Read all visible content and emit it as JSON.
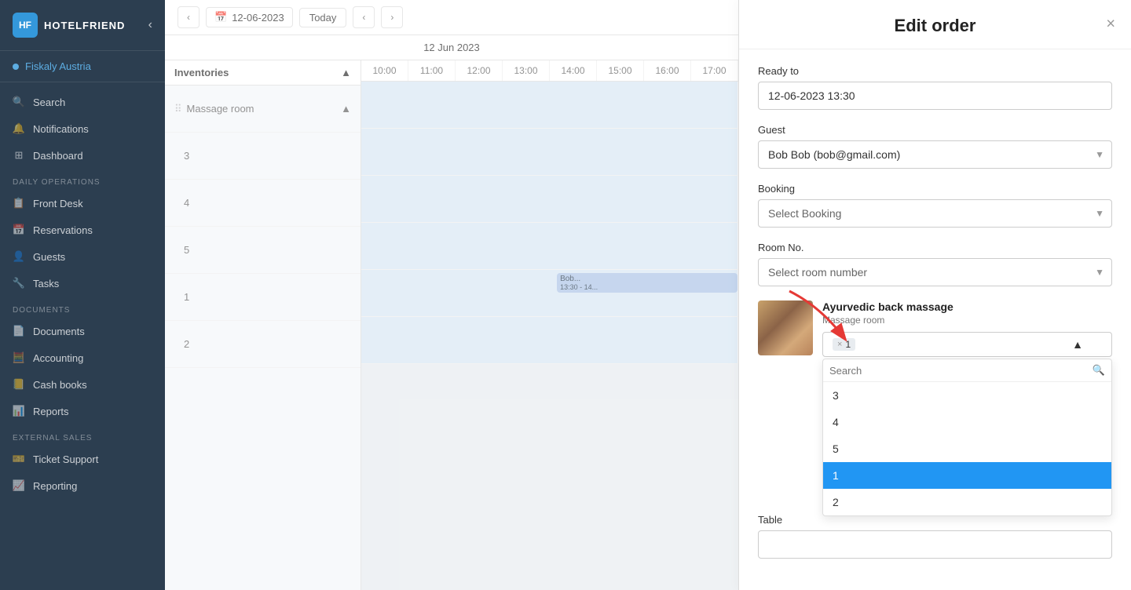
{
  "sidebar": {
    "logo_text": "HOTELFRIEND",
    "property": "Fiskaly Austria",
    "nav_items": [
      {
        "id": "search",
        "label": "Search",
        "icon": "🔍",
        "section": null
      },
      {
        "id": "notifications",
        "label": "Notifications",
        "icon": "🔔",
        "section": null
      },
      {
        "id": "dashboard",
        "label": "Dashboard",
        "icon": "⊞",
        "section": null
      },
      {
        "id": "section_daily",
        "label": "DAILY OPERATIONS",
        "is_section": true
      },
      {
        "id": "front-desk",
        "label": "Front Desk",
        "icon": "📋",
        "section": "daily"
      },
      {
        "id": "reservations",
        "label": "Reservations",
        "icon": "📅",
        "section": "daily"
      },
      {
        "id": "guests",
        "label": "Guests",
        "icon": "👤",
        "section": "daily"
      },
      {
        "id": "tasks",
        "label": "Tasks",
        "icon": "🔧",
        "section": "daily"
      },
      {
        "id": "section_docs",
        "label": "DOCUMENTS",
        "is_section": true
      },
      {
        "id": "documents",
        "label": "Documents",
        "icon": "📄",
        "section": "docs"
      },
      {
        "id": "accounting",
        "label": "Accounting",
        "icon": "🧮",
        "section": "docs"
      },
      {
        "id": "cash-books",
        "label": "Cash books",
        "icon": "📒",
        "section": "docs"
      },
      {
        "id": "reports",
        "label": "Reports",
        "icon": "📊",
        "section": "docs"
      },
      {
        "id": "section_ext",
        "label": "EXTERNAL SALES",
        "is_section": true
      },
      {
        "id": "ticket-support",
        "label": "Ticket Support",
        "icon": "🎫",
        "section": "ext"
      },
      {
        "id": "reporting",
        "label": "Reporting",
        "icon": "📈",
        "section": "ext"
      }
    ]
  },
  "calendar": {
    "date_display": "12-06-2023",
    "today_label": "Today",
    "header_date": "12 Jun 2023",
    "inventories_label": "Inventories",
    "time_slots": [
      "10:00",
      "11:00",
      "12:00",
      "13:00",
      "14:00",
      "15:00",
      "16:00",
      "17:00"
    ],
    "rows": [
      "Massage room"
    ],
    "row_numbers": [
      "3",
      "4",
      "5",
      "1",
      "2"
    ],
    "event": {
      "label": "Bob...",
      "time": "13:30 - 14...",
      "col": 4
    }
  },
  "edit_order": {
    "title": "Edit order",
    "close_label": "×",
    "fields": {
      "ready_to_label": "Ready to",
      "ready_to_value": "12-06-2023 13:30",
      "guest_label": "Guest",
      "guest_value": "Bob Bob (bob@gmail.com)",
      "booking_label": "Booking",
      "booking_placeholder": "Select Booking",
      "room_no_label": "Room No.",
      "room_no_placeholder": "Select room number",
      "table_label": "Table"
    },
    "product": {
      "name": "Ayurvedic back massage",
      "location": "Massage room",
      "qty_label": "× 1",
      "qty_tag_x": "×",
      "qty_value": "1"
    },
    "dropdown": {
      "search_placeholder": "Search",
      "options": [
        {
          "value": "3",
          "label": "3",
          "selected": false
        },
        {
          "value": "4",
          "label": "4",
          "selected": false
        },
        {
          "value": "5",
          "label": "5",
          "selected": false
        },
        {
          "value": "1",
          "label": "1",
          "selected": true
        },
        {
          "value": "2",
          "label": "2",
          "selected": false
        }
      ]
    }
  }
}
